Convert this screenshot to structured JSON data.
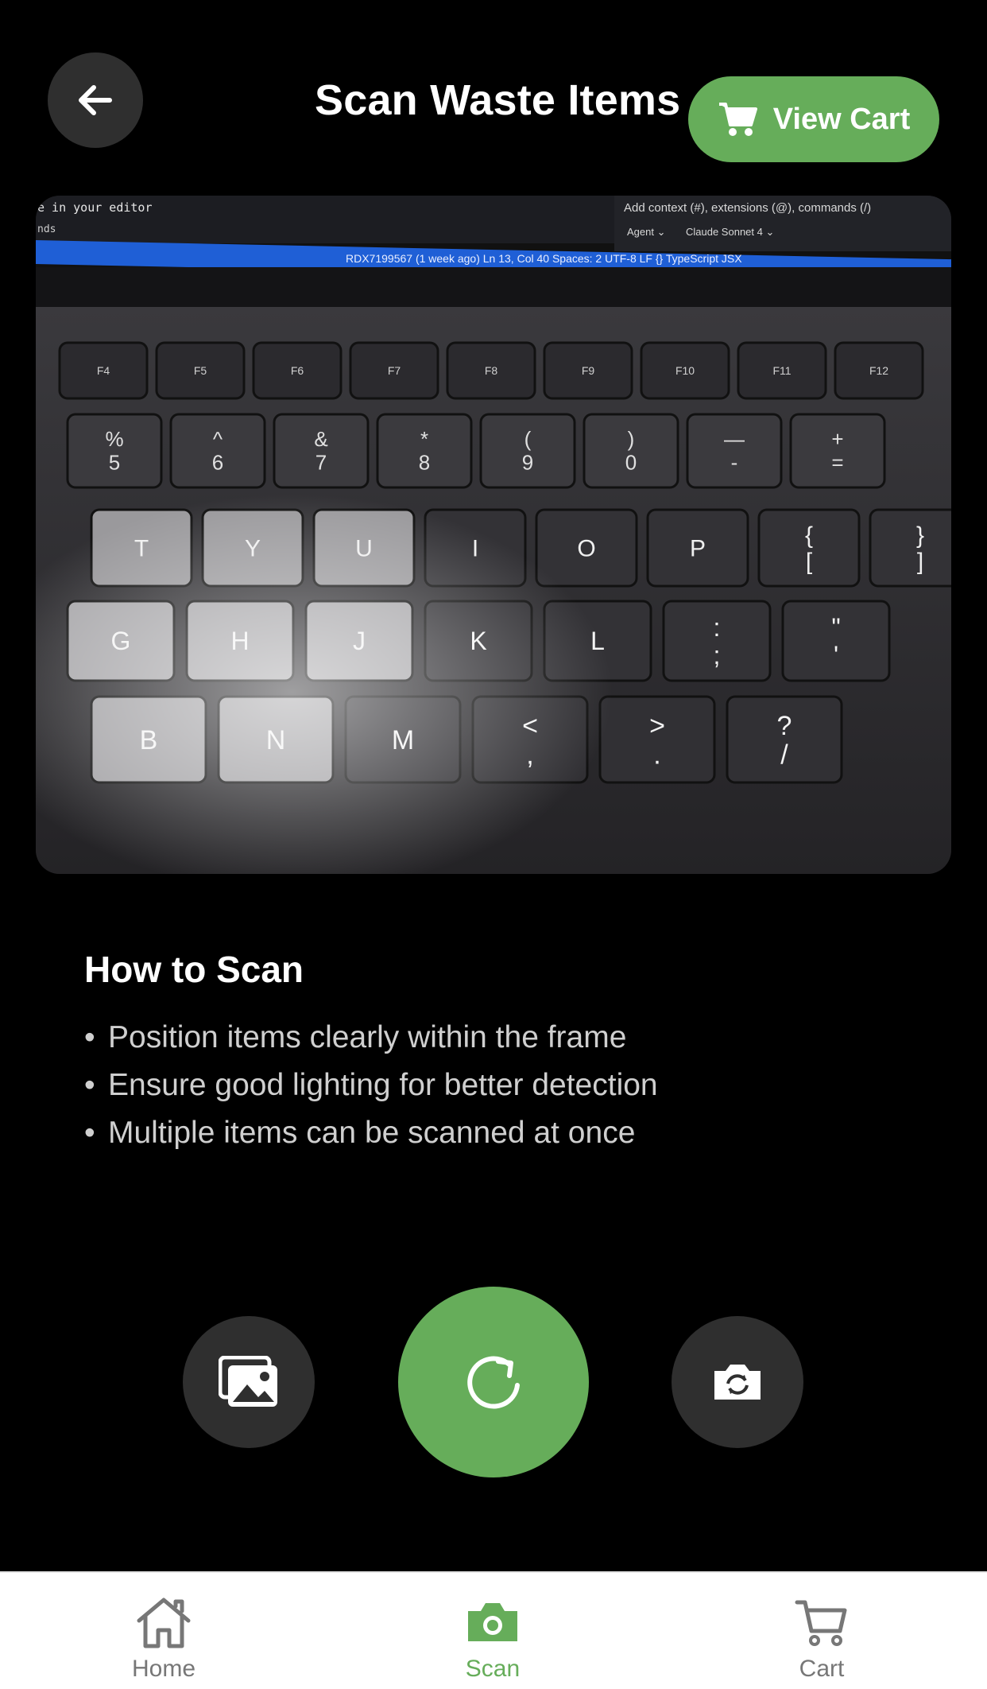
{
  "header": {
    "title": "Scan Waste Items",
    "view_cart_label": "View Cart"
  },
  "instructions": {
    "title": "How to Scan",
    "tips": [
      "Position items clearly within the frame",
      "Ensure good lighting for better detection",
      "Multiple items can be scanned at once"
    ]
  },
  "preview": {
    "editor_hint": "e in your editor",
    "editor_hint2": "nds",
    "chat_prompt": "Add context (#), extensions (@), commands (/)",
    "agent": "Agent ⌄",
    "model": "Claude Sonnet 4 ⌄",
    "status_bar": "RDX7199567 (1 week ago)   Ln 13, Col 40   Spaces: 2   UTF-8   LF   {} TypeScript JSX",
    "fn_keys": [
      "F4",
      "F5",
      "F6",
      "F7",
      "F8",
      "F9",
      "F10",
      "F11",
      "F12"
    ],
    "num_keys": [
      {
        "top": "%",
        "bottom": "5"
      },
      {
        "top": "^",
        "bottom": "6"
      },
      {
        "top": "&",
        "bottom": "7"
      },
      {
        "top": "*",
        "bottom": "8"
      },
      {
        "top": "(",
        "bottom": "9"
      },
      {
        "top": ")",
        "bottom": "0"
      },
      {
        "top": "—",
        "bottom": "-"
      },
      {
        "top": "+",
        "bottom": "="
      }
    ],
    "row_top": [
      "T",
      "Y",
      "U",
      "I",
      "O",
      "P",
      "{ [",
      "} ]"
    ],
    "row_mid": [
      "G",
      "H",
      "J",
      "K",
      "L",
      ": ;",
      "\" '"
    ],
    "row_bot": [
      "B",
      "N",
      "M",
      "< ,",
      "> .",
      "? /"
    ]
  },
  "controls": {
    "gallery_icon": "gallery-icon",
    "capture_icon": "refresh-icon",
    "flip_icon": "camera-flip-icon"
  },
  "nav": {
    "items": [
      {
        "label": "Home",
        "icon": "home-icon"
      },
      {
        "label": "Scan",
        "icon": "camera-icon"
      },
      {
        "label": "Cart",
        "icon": "cart-icon"
      }
    ],
    "active_color": "#66ad5a",
    "inactive_color": "#777777"
  },
  "colors": {
    "accent": "#66ad5a",
    "background": "#000000",
    "button_dark": "#2f2f2f"
  }
}
